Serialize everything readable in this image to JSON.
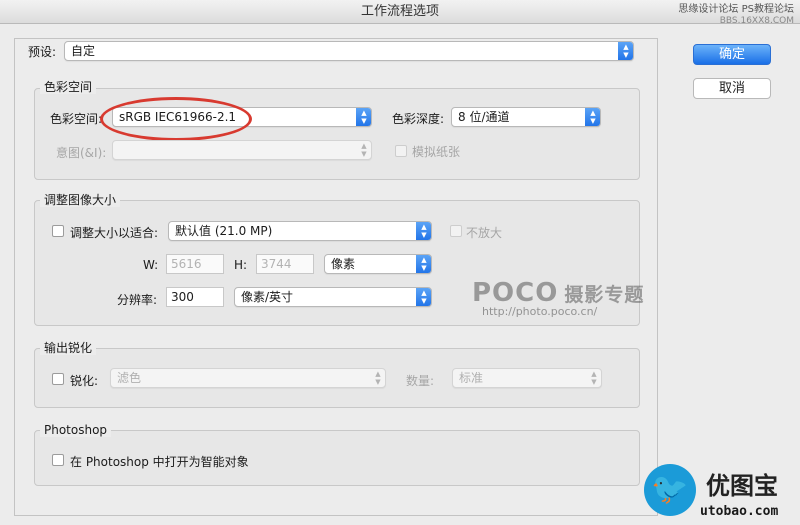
{
  "window": {
    "title": "工作流程选项"
  },
  "watermarks": {
    "top_line1": "思缘设计论坛",
    "top_line2": "PS教程论坛",
    "top_line3": "BBS.16XX8.COM"
  },
  "preset": {
    "label": "预设:",
    "value": "自定"
  },
  "buttons": {
    "ok": "确定",
    "cancel": "取消"
  },
  "color_space": {
    "group_title": "色彩空间",
    "space_label": "色彩空间:",
    "space_value": "sRGB IEC61966-2.1",
    "depth_label": "色彩深度:",
    "depth_value": "8 位/通道",
    "intent_label": "意图(&I):",
    "intent_value": "",
    "simulate_paper_label": "模拟纸张"
  },
  "resize": {
    "group_title": "调整图像大小",
    "fit_label": "调整大小以适合:",
    "fit_value": "默认值 (21.0 MP)",
    "no_enlarge_label": "不放大",
    "w_label": "W:",
    "w_value": "5616",
    "h_label": "H:",
    "h_value": "3744",
    "unit_value": "像素",
    "resolution_label": "分辨率:",
    "resolution_value": "300",
    "resolution_unit_value": "像素/英寸"
  },
  "sharpen": {
    "group_title": "输出锐化",
    "sharpen_label": "锐化:",
    "sharpen_value": "滤色",
    "amount_label": "数量:",
    "amount_value": "标准"
  },
  "photoshop": {
    "group_title": "Photoshop",
    "smart_object_label": "在 Photoshop 中打开为智能对象"
  },
  "branding": {
    "poco": "POCO",
    "poco_cn": "摄影专题",
    "poco_url": "http://photo.poco.cn/",
    "site_cn": "优图宝",
    "site_url": "utobao.com"
  },
  "colors": {
    "accent": "#1f72e8",
    "highlight_oval": "#d83a30"
  }
}
